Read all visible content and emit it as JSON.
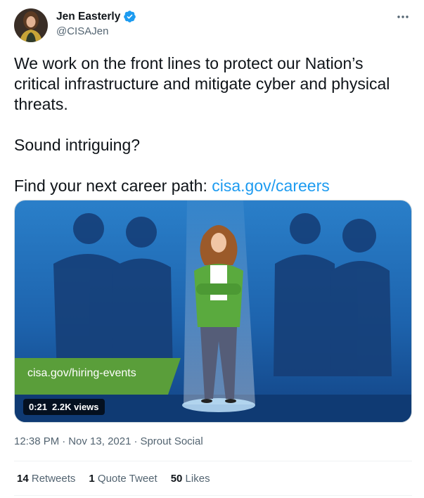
{
  "author": {
    "display_name": "Jen Easterly",
    "handle": "@CISAJen",
    "verified": true,
    "avatar_icon": "profile-photo"
  },
  "tweet": {
    "line1": "We work on the front lines to protect our Nation’s critical infrastructure and mitigate cyber and physical threats.",
    "line2": "Sound intriguing?",
    "line3_prefix": "Find your next career path: ",
    "line3_link": "cisa.gov/careers"
  },
  "media": {
    "banner_text": "cisa.gov/hiring-events",
    "duration": "0:21",
    "views": "2.2K views",
    "banner_color": "#5a9e3a"
  },
  "meta": {
    "time": "12:38 PM",
    "sep1": "·",
    "date": "Nov 13, 2021",
    "sep2": "·",
    "source": "Sprout Social"
  },
  "stats": {
    "retweets_count": "14",
    "retweets_label": "Retweets",
    "quotes_count": "1",
    "quotes_label": "Quote Tweet",
    "likes_count": "50",
    "likes_label": "Likes"
  },
  "colors": {
    "link": "#1d9bf0",
    "text": "#0f1419",
    "secondary": "#536471"
  }
}
